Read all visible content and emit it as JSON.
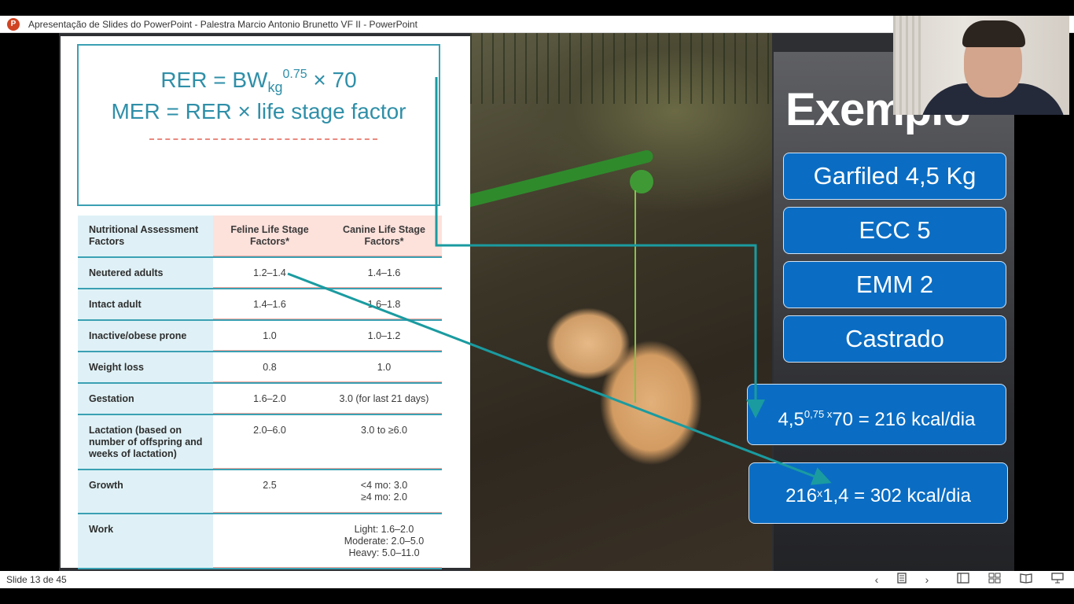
{
  "window": {
    "title": "Apresentação de Slides do PowerPoint  -  Palestra Marcio Antonio Brunetto VF II - PowerPoint",
    "app_icon": "P"
  },
  "slide": {
    "formulas": {
      "rer_prefix": "RER = BW",
      "rer_sub": "kg",
      "rer_sup": "0.75",
      "rer_suffix": " × 70",
      "mer": "MER = RER × life stage factor"
    },
    "table": {
      "headers": [
        "Nutritional Assessment Factors",
        "Feline Life Stage Factors*",
        "Canine Life Stage Factors*"
      ],
      "rows": [
        [
          "Neutered adults",
          "1.2–1.4",
          "1.4–1.6"
        ],
        [
          "Intact adult",
          "1.4–1.6",
          "1.6–1.8"
        ],
        [
          "Inactive/obese prone",
          "1.0",
          "1.0–1.2"
        ],
        [
          "Weight loss",
          "0.8",
          "1.0"
        ],
        [
          "Gestation",
          "1.6–2.0",
          "3.0 (for last 21 days)"
        ],
        [
          "Lactation (based on number of offspring and weeks of lactation)",
          "2.0–6.0",
          "3.0 to ≥6.0"
        ],
        [
          "Growth",
          "2.5",
          "<4 mo: 3.0 ≥4 mo: 2.0"
        ],
        [
          "Work",
          "",
          "Light: 1.6–2.0 Moderate: 2.0–5.0 Heavy: 5.0–11.0"
        ]
      ]
    },
    "panel": {
      "title": "Exemplo",
      "items": [
        "Garfiled 4,5 Kg",
        "ECC 5",
        "EMM 2",
        "Castrado"
      ],
      "calc1": {
        "base": "4,5",
        "sup": "0,75 x",
        "rest": "70 = 216 kcal/dia"
      },
      "calc2": {
        "base": "216",
        "sup": "x",
        "rest": "1,4 = 302 kcal/dia"
      }
    },
    "accent_color": "#0a6dc3",
    "arrow_color": "#1a9ba0"
  },
  "statusbar": {
    "slide_indicator": "Slide 13 de 45",
    "buttons": [
      "previous-icon",
      "slides-list-icon",
      "next-icon",
      "normal-view-icon",
      "slide-sorter-icon",
      "reading-view-icon",
      "slideshow-icon"
    ]
  }
}
